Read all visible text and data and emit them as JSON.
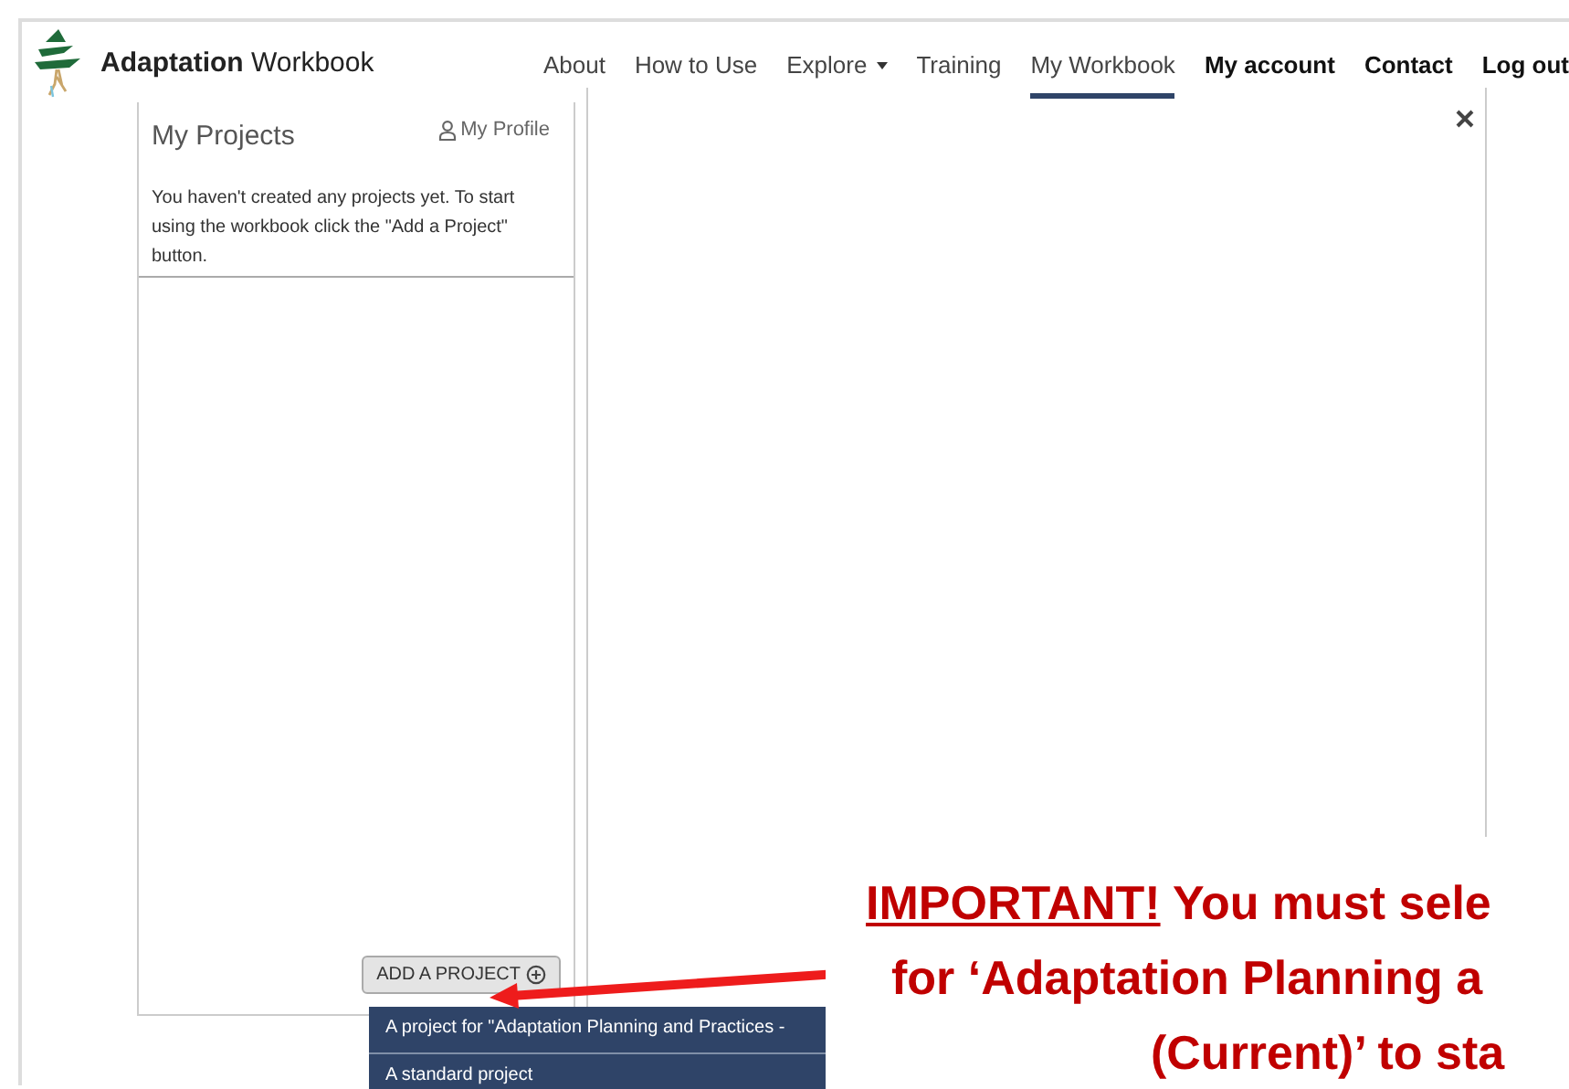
{
  "site": {
    "title_bold": "Adaptation",
    "title_rest": "Workbook"
  },
  "nav": [
    {
      "label": "About",
      "kind": "link",
      "dropdown": false,
      "selected": false
    },
    {
      "label": "How to Use",
      "kind": "link",
      "dropdown": false,
      "selected": false
    },
    {
      "label": "Explore",
      "kind": "link",
      "dropdown": true,
      "selected": false
    },
    {
      "label": "Training",
      "kind": "link",
      "dropdown": false,
      "selected": false
    },
    {
      "label": "My Workbook",
      "kind": "link",
      "dropdown": false,
      "selected": true
    },
    {
      "label": "My account",
      "kind": "account",
      "dropdown": false,
      "selected": false
    },
    {
      "label": "Contact",
      "kind": "account",
      "dropdown": false,
      "selected": false
    },
    {
      "label": "Log out",
      "kind": "account",
      "dropdown": false,
      "selected": false
    }
  ],
  "projects_panel": {
    "title": "My Projects",
    "profile_link": "My Profile",
    "message": "You haven't created any projects yet.  To start using the workbook click the \"Add a Project\" button.",
    "add_button": "ADD A PROJECT"
  },
  "add_menu": {
    "items": [
      "A project for \"Adaptation Planning and Practices -",
      "A standard project"
    ]
  },
  "annotation": {
    "lines": [
      "**IMPORTANT!** You must sele",
      "for ‘Adaptation Planning a",
      "(Current)’ to sta"
    ]
  }
}
